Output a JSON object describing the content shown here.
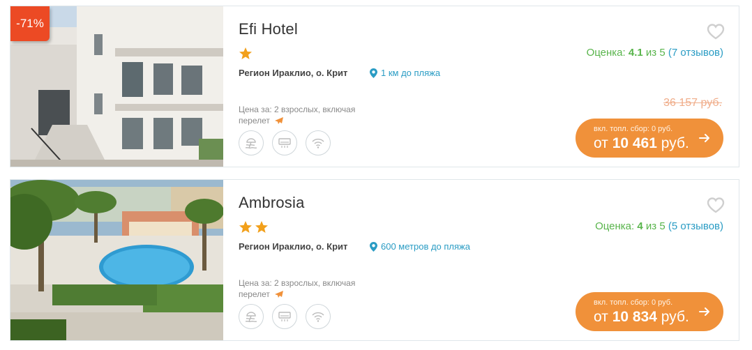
{
  "hotels": [
    {
      "name": "Efi Hotel",
      "discount": "-71%",
      "stars": 1,
      "region": "Регион Ираклио, о. Крит",
      "beach": "1 км до пляжа",
      "price_for_line1": "Цена за: 2 взрослых, включая",
      "price_for_line2": "перелет",
      "rating_prefix": "Оценка:",
      "rating_value": "4.1",
      "rating_of": "из 5",
      "reviews": "(7 отзывов)",
      "old_price": "36 157 руб.",
      "fees": "вкл. топл. сбор: 0 руб.",
      "price_from": "от",
      "price": "10 461",
      "currency": "руб.",
      "amenities": [
        "beach-icon",
        "air-conditioner-icon",
        "wifi-icon"
      ]
    },
    {
      "name": "Ambrosia",
      "stars": 2,
      "region": "Регион Ираклио, о. Крит",
      "beach": "600 метров до пляжа",
      "price_for_line1": "Цена за: 2 взрослых, включая",
      "price_for_line2": "перелет",
      "rating_prefix": "Оценка:",
      "rating_value": "4",
      "rating_of": "из 5",
      "reviews": "(5 отзывов)",
      "fees": "вкл. топл. сбор: 0 руб.",
      "price_from": "от",
      "price": "10 834",
      "currency": "руб.",
      "amenities": [
        "beach-icon",
        "air-conditioner-icon",
        "wifi-icon"
      ]
    }
  ],
  "colors": {
    "accent_orange": "#f0913a",
    "discount_red": "#ec4a24",
    "rating_green": "#58b44b",
    "link_blue": "#2a9cc4",
    "star_gold": "#f2a01b"
  }
}
